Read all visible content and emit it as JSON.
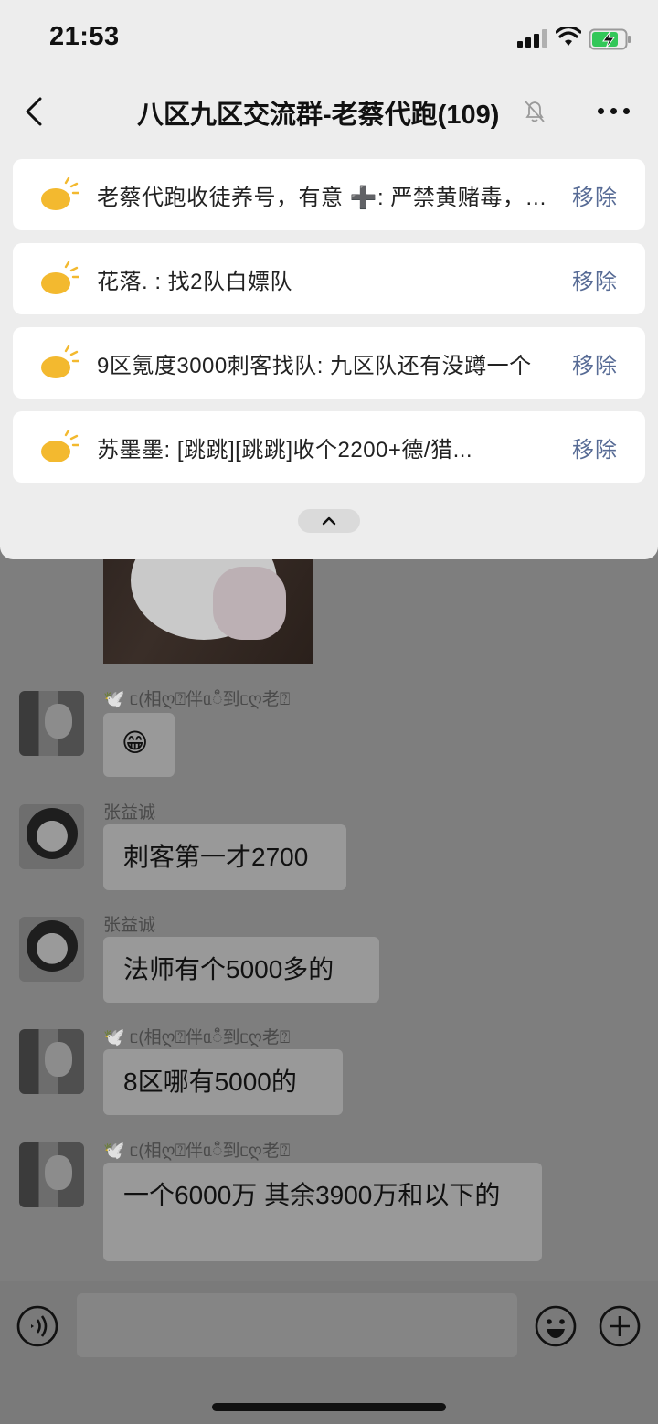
{
  "status_bar": {
    "time": "21:53"
  },
  "header": {
    "title": "八区九区交流群-老蔡代跑(109)"
  },
  "notices": [
    {
      "text": "老蔡代跑收徒养号，有意 ➕: 严禁黄赌毒，骗子勿扰",
      "action": "移除"
    },
    {
      "text": "花落.  : 找2队白嫖队",
      "action": "移除"
    },
    {
      "text": "9区氪度3000刺客找队: 九区队还有没蹲一个",
      "action": "移除"
    },
    {
      "text": "苏墨墨: [跳跳][跳跳]收个2200+德/猎...",
      "action": "移除"
    }
  ],
  "messages": [
    {
      "sender": "🕊️ ᥴ(相ღ⍰伴ᥲ◌ᩧ到ᥴღ老⍰",
      "text": "😁"
    },
    {
      "sender": "张益诚",
      "text": "刺客第一才2700"
    },
    {
      "sender": "张益诚",
      "text": "法师有个5000多的"
    },
    {
      "sender": "🕊️ ᥴ(相ღ⍰伴ᥲ◌ᩧ到ᥴღ老⍰",
      "text": "8区哪有5000的"
    },
    {
      "sender": "🕊️ ᥴ(相ღ⍰伴ᥲ◌ᩧ到ᥴღ老⍰",
      "text": "一个6000万 其余3900万和以下的"
    }
  ],
  "colors": {
    "link": "#576b95",
    "drawer_bg": "#ededed",
    "dim_bg": "#7e7e7e"
  },
  "icons": [
    "back-icon",
    "mute-bell-icon",
    "more-icon",
    "bulb-icon",
    "chevron-up-icon",
    "voice-icon",
    "emoji-icon",
    "plus-icon"
  ]
}
